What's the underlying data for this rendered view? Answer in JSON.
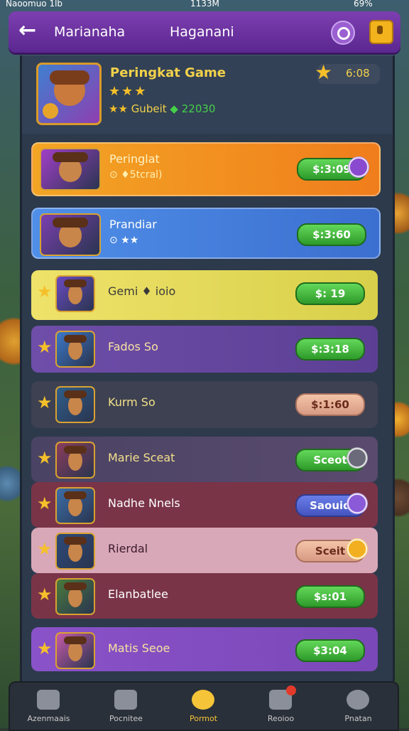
{
  "status_bar": {
    "left": "Naoomuo 1lb",
    "time": "1133M",
    "battery": "69%"
  },
  "top_bar": {
    "title_left": "Marianaha",
    "title_right": "Haganani"
  },
  "header": {
    "name": "Peringkat Game",
    "stars": "★★★",
    "sub_stars": "★★",
    "sub_label": "Gubeit",
    "gem": "◆",
    "points": "22030",
    "coins": "6:08"
  },
  "rows": [
    {
      "name": "Peringlat",
      "sub": "⊙ ♦5tcral)",
      "price": "$:3:09",
      "style": "orange"
    },
    {
      "name": "Prandiar",
      "sub": "⊙ ★★",
      "price": "$:3:60",
      "style": "blue"
    },
    {
      "name": "Gemi ♦ ioio",
      "sub": "",
      "price": "$: 19",
      "style": "yellow"
    },
    {
      "name": "Fados So",
      "sub": "",
      "price": "$:3:18",
      "style": "violet"
    },
    {
      "name": "Kurm So",
      "sub": "",
      "price": "$:1:60",
      "style": "dark"
    },
    {
      "name": "Marie Sceat",
      "sub": "",
      "price": "Sceot",
      "style": "dark2"
    },
    {
      "name": "Nadhe Nnels",
      "sub": "",
      "price": "Saouid",
      "style": "maroon"
    },
    {
      "name": "Rierdal",
      "sub": "",
      "price": "Sceit",
      "style": "pinklight"
    },
    {
      "name": "Elanbatlee",
      "sub": "",
      "price": "$s:01",
      "style": "maroon2"
    },
    {
      "name": "Matis Seoe",
      "sub": "",
      "price": "$3:04",
      "style": "purple"
    }
  ],
  "nav": [
    {
      "label": "Azenmaais",
      "icon": "home-icon"
    },
    {
      "label": "Pocnitee",
      "icon": "shield-icon"
    },
    {
      "label": "Pormot",
      "icon": "compass-icon"
    },
    {
      "label": "Reoioo",
      "icon": "chat-icon"
    },
    {
      "label": "Pnatan",
      "icon": "clock-icon"
    }
  ],
  "colors": {
    "accent_purple": "#7d3fb0",
    "gold": "#f6c02a",
    "green_btn": "#3bb232"
  }
}
